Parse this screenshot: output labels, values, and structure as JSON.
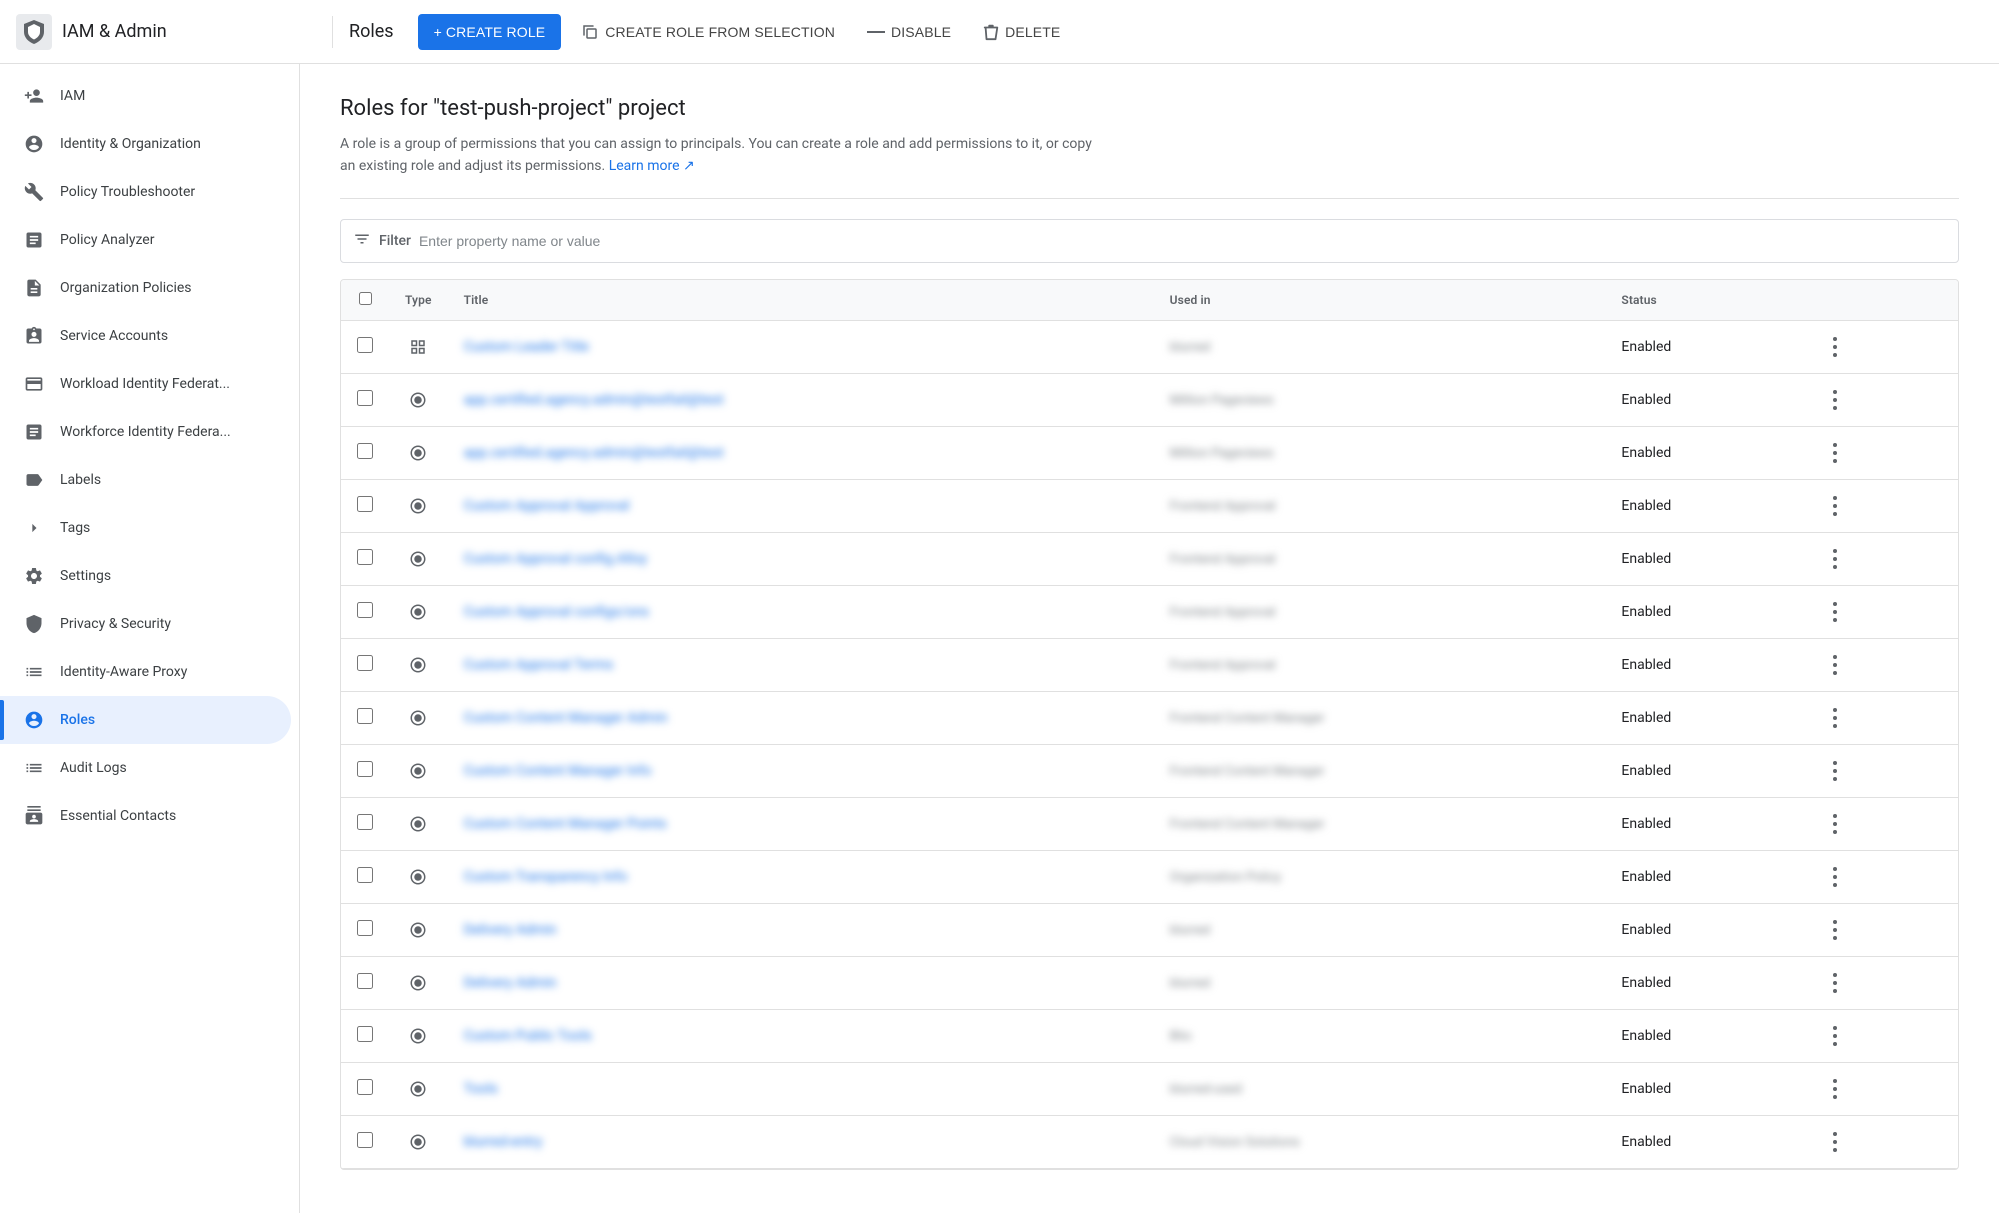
{
  "app": {
    "logo_text": "IAM & Admin",
    "section_title": "Roles"
  },
  "toolbar": {
    "create_role_label": "+ CREATE ROLE",
    "create_role_selection_label": "CREATE ROLE FROM SELECTION",
    "disable_label": "DISABLE",
    "delete_label": "DELETE"
  },
  "page": {
    "title": "Roles for \"test-push-project\" project",
    "description": "A role is a group of permissions that you can assign to principals. You can create a role and add permissions to it, or copy an existing role and adjust its permissions.",
    "learn_more": "Learn more"
  },
  "filter": {
    "label": "Filter",
    "placeholder": "Enter property name or value"
  },
  "table": {
    "columns": [
      "",
      "Type",
      "Title",
      "Used in",
      "Status",
      ""
    ],
    "rows": [
      {
        "type": "grid",
        "title": "blurred-title-1",
        "used_in": "blurred-used-1",
        "status": "Enabled"
      },
      {
        "type": "radio",
        "title": "blurred-title-2",
        "used_in": "blurred-used-2",
        "status": "Enabled"
      },
      {
        "type": "radio",
        "title": "blurred-title-3",
        "used_in": "blurred-used-3",
        "status": "Enabled"
      },
      {
        "type": "radio",
        "title": "blurred-title-4",
        "used_in": "blurred-used-4",
        "status": "Enabled"
      },
      {
        "type": "radio",
        "title": "blurred-title-5",
        "used_in": "blurred-used-5",
        "status": "Enabled"
      },
      {
        "type": "radio",
        "title": "blurred-title-6",
        "used_in": "blurred-used-6",
        "status": "Enabled"
      },
      {
        "type": "radio",
        "title": "blurred-title-7",
        "used_in": "blurred-used-7",
        "status": "Enabled"
      },
      {
        "type": "radio",
        "title": "blurred-title-8",
        "used_in": "blurred-used-8",
        "status": "Enabled"
      },
      {
        "type": "radio",
        "title": "blurred-title-9",
        "used_in": "blurred-used-9",
        "status": "Enabled"
      },
      {
        "type": "radio",
        "title": "blurred-title-10",
        "used_in": "blurred-used-10",
        "status": "Enabled"
      },
      {
        "type": "radio",
        "title": "blurred-title-11",
        "used_in": "blurred-used-11",
        "status": "Enabled"
      },
      {
        "type": "radio",
        "title": "blurred-title-12",
        "used_in": "blurred-used-12",
        "status": "Enabled"
      },
      {
        "type": "radio",
        "title": "blurred-title-13",
        "used_in": "blurred-used-13",
        "status": "Enabled"
      },
      {
        "type": "radio",
        "title": "blurred-title-14",
        "used_in": "blurred-used-14",
        "status": "Enabled"
      },
      {
        "type": "radio",
        "title": "blurred-title-15",
        "used_in": "blurred-used-15",
        "status": "Enabled"
      },
      {
        "type": "radio",
        "title": "blurred-title-16",
        "used_in": "blurred-used-16",
        "status": "Enabled"
      }
    ],
    "blurred_titles": [
      "Custom Leader Title",
      "app.certified.agency.admin@testfail@test",
      "app.certified.agency.admin@testfail@test",
      "Custom Approval Approval",
      "Custom Approval config.Alloy",
      "Custom Approval configs/ons",
      "Custom Approval Terms",
      "Custom Content Manager Admin",
      "Custom Content Manager Info",
      "Custom Content Manager Points",
      "Custom Transparency Info",
      "Delivery Admin",
      "Delivery Admin",
      "Custom Public Tools",
      "Tools",
      ""
    ],
    "blurred_used_in": [
      "blurred",
      "Million Pageviews",
      "Million Pageviews",
      "Frontend Approval",
      "Frontend Approval",
      "Frontend Approval",
      "Frontend Approval",
      "Frontend Content Manager",
      "Frontend Content Manager",
      "Frontend Content Manager",
      "Organization Policy",
      "blurred",
      "blurred",
      "Blio",
      "",
      "Cloud Vision Solutions"
    ],
    "status_label": "Enabled"
  },
  "sidebar": {
    "items": [
      {
        "id": "iam",
        "label": "IAM",
        "icon": "person-add"
      },
      {
        "id": "identity-org",
        "label": "Identity & Organization",
        "icon": "account-circle"
      },
      {
        "id": "policy-troubleshooter",
        "label": "Policy Troubleshooter",
        "icon": "wrench"
      },
      {
        "id": "policy-analyzer",
        "label": "Policy Analyzer",
        "icon": "article"
      },
      {
        "id": "org-policies",
        "label": "Organization Policies",
        "icon": "description"
      },
      {
        "id": "service-accounts",
        "label": "Service Accounts",
        "icon": "assignment-ind"
      },
      {
        "id": "workload-identity",
        "label": "Workload Identity Federat...",
        "icon": "credit-card"
      },
      {
        "id": "workforce-identity",
        "label": "Workforce Identity Federa...",
        "icon": "list-alt"
      },
      {
        "id": "labels",
        "label": "Labels",
        "icon": "label"
      },
      {
        "id": "tags",
        "label": "Tags",
        "icon": "chevron-right"
      },
      {
        "id": "settings",
        "label": "Settings",
        "icon": "settings"
      },
      {
        "id": "privacy-security",
        "label": "Privacy & Security",
        "icon": "shield"
      },
      {
        "id": "identity-aware-proxy",
        "label": "Identity-Aware Proxy",
        "icon": "list"
      },
      {
        "id": "roles",
        "label": "Roles",
        "icon": "person",
        "active": true
      },
      {
        "id": "audit-logs",
        "label": "Audit Logs",
        "icon": "list"
      },
      {
        "id": "essential-contacts",
        "label": "Essential Contacts",
        "icon": "contact-page"
      }
    ]
  }
}
